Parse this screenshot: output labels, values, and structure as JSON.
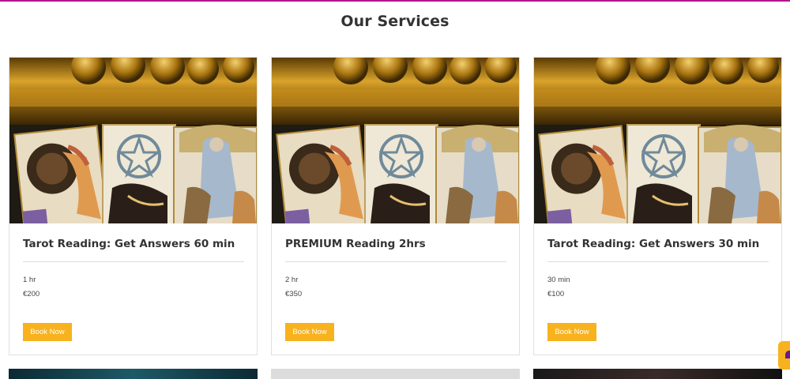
{
  "page": {
    "title": "Our Services"
  },
  "services": [
    {
      "title": "Tarot Reading: Get Answers 60 min",
      "duration": "1 hr",
      "price": "€200",
      "button": "Book Now"
    },
    {
      "title": "PREMIUM Reading 2hrs",
      "duration": "2 hr",
      "price": "€350",
      "button": "Book Now"
    },
    {
      "title": "Tarot Reading: Get Answers 30 min",
      "duration": "30 min",
      "price": "€100",
      "button": "Book Now"
    }
  ],
  "colors": {
    "accent_line": "#b0158e",
    "button": "#f7b21d",
    "chat_glyph": "#6d1a88"
  },
  "icons": {
    "chat": "chat-bubble-icon"
  }
}
